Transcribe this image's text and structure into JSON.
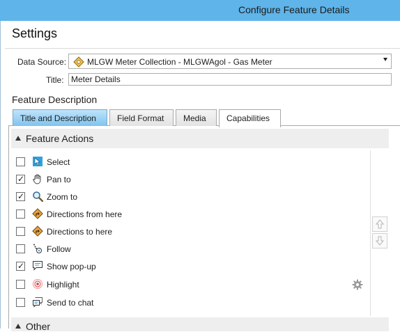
{
  "window": {
    "title": "Configure Feature Details"
  },
  "settings": {
    "heading": "Settings"
  },
  "form": {
    "data_source_label": "Data Source:",
    "data_source_value": "MLGW Meter Collection - MLGWAgol - Gas Meter",
    "title_label": "Title:",
    "title_value": "Meter Details"
  },
  "feature_description": {
    "heading": "Feature Description"
  },
  "tabs": [
    {
      "label": "Title and Description"
    },
    {
      "label": "Field Format"
    },
    {
      "label": "Media"
    },
    {
      "label": "Capabilities"
    }
  ],
  "groups": {
    "feature_actions": "Feature Actions",
    "other": "Other"
  },
  "actions": [
    {
      "label": "Select",
      "checked": false,
      "icon": "select-icon"
    },
    {
      "label": "Pan to",
      "checked": true,
      "icon": "pan-hand-icon"
    },
    {
      "label": "Zoom to",
      "checked": true,
      "icon": "zoom-magnifier-icon"
    },
    {
      "label": "Directions from here",
      "checked": false,
      "icon": "directions-icon"
    },
    {
      "label": "Directions to here",
      "checked": false,
      "icon": "directions-icon"
    },
    {
      "label": "Follow",
      "checked": false,
      "icon": "follow-icon"
    },
    {
      "label": "Show pop-up",
      "checked": true,
      "icon": "popup-icon"
    },
    {
      "label": "Highlight",
      "checked": false,
      "icon": "highlight-icon"
    },
    {
      "label": "Send to chat",
      "checked": false,
      "icon": "chat-icon"
    }
  ],
  "colors": {
    "titlebar": "#5fb4e9",
    "active_tab_blue": "#7fc4ef",
    "directions_orange": "#e8a23a"
  }
}
